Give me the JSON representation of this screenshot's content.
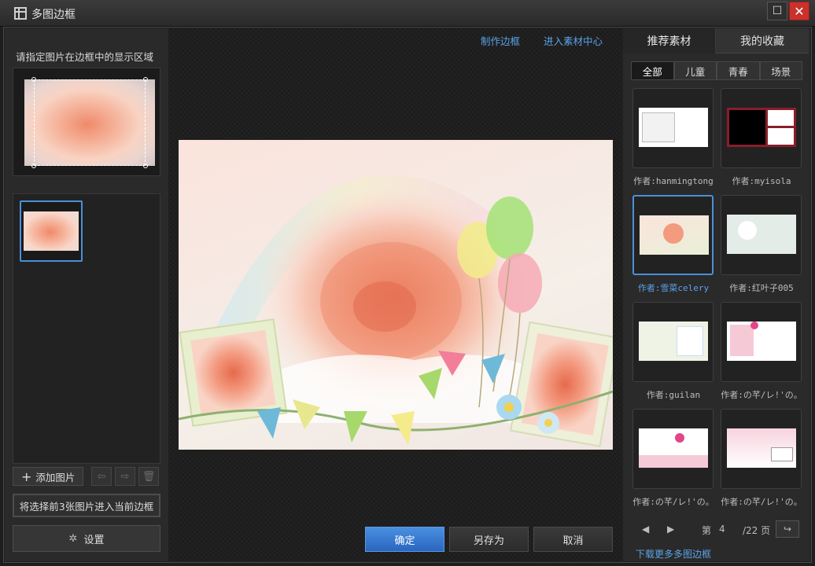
{
  "window": {
    "title": "多图边框"
  },
  "left": {
    "hint": "请指定图片在边框中的显示区域",
    "add_label": "添加图片",
    "import_label": "将选择前3张图片进入当前边框",
    "settings_label": "设置"
  },
  "center": {
    "links": [
      "制作边框",
      "进入素材中心"
    ],
    "buttons": {
      "ok": "确定",
      "save_as": "另存为",
      "cancel": "取消"
    }
  },
  "right": {
    "tabs": [
      "推荐素材",
      "我的收藏"
    ],
    "subtabs": [
      "全部",
      "儿童",
      "青春",
      "场景"
    ],
    "items": [
      {
        "author": "作者:hanmingtong"
      },
      {
        "author": "作者:myisola"
      },
      {
        "author": "作者:雪菜celery"
      },
      {
        "author": "作者:红叶子005"
      },
      {
        "author": "作者:guilan"
      },
      {
        "author": "作者:の芊/レ!'の。"
      },
      {
        "author": "作者:の芊/レ!'の。"
      },
      {
        "author": "作者:の芊/レ!'の。"
      }
    ],
    "pager": {
      "prefix": "第",
      "current": "4",
      "total": "/22 页"
    },
    "more_link": "下载更多多图边框"
  }
}
